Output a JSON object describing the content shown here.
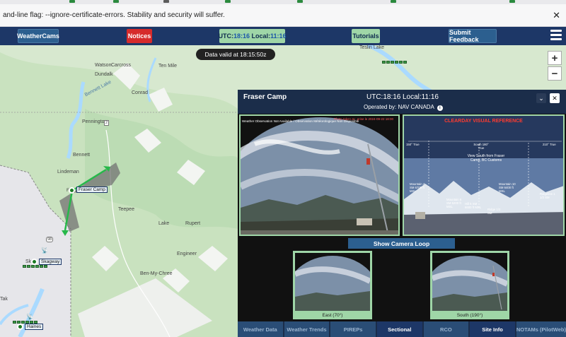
{
  "browser": {
    "warning": "and-line flag: --ignore-certificate-errors. Stability and security will suffer.",
    "close_icon": "close-icon",
    "tab_favicon_colors": [
      "#2b8a3e",
      "#2b8a3e",
      "#5b5b5b",
      "#2b8a3e",
      "#2b8a3e",
      "#2b8a3e",
      "#2b8a3e"
    ]
  },
  "nav": {
    "weathercams": "WeatherCams",
    "notices": "Notices",
    "utc_label": "UTC:",
    "utc_time": "18:16",
    "local_label": " Local:",
    "local_time": "11:16",
    "tutorials": "Tutorials",
    "feedback": "Submit Feedback",
    "menu_icon": "hamburger-menu-icon"
  },
  "map": {
    "validity": "Data valid at 18:15:50z",
    "zoom_in": "+",
    "zoom_out": "−",
    "places": [
      "Teslin Lake",
      "Carcross",
      "Ten Mile",
      "Watson",
      "Bennett Lake",
      "Dundalk",
      "Conrad",
      "Pennington",
      "Bennett",
      "Lindeman",
      "Teepee",
      "Lake",
      "Rupert",
      "Engineer",
      "Ben-My-Chree",
      "Sk",
      "Tak"
    ],
    "sites": [
      "Fraser Camp",
      "Skagway",
      "Haines"
    ],
    "markers": [
      "2",
      "98",
      "F"
    ],
    "colors": {
      "water": "#aadaff",
      "land": "#d7e8cf",
      "green": "#bcdcb4",
      "border": "#888888"
    }
  },
  "panel": {
    "site_name": "Fraser Camp",
    "utc": "UTC:18:16",
    "local": "Local:11:16",
    "operator": "Operated by: NAV CANADA",
    "collapse_icon": "chevron-down-icon",
    "close_icon": "close-icon",
    "info_icon": "info-icon",
    "camera_overlay": "Weather Observation Not Available / Observation Météorologique Non Disponible",
    "camera_timestamp": "Photo taken at : prise le 2024-09-22 18:00",
    "reference_title": "CLEARDAY VISUAL REFERENCE",
    "reference_note": "View South from Fraser Camp, BC Customs",
    "reference_bearings": [
      "150° True",
      "South 180° True",
      "210° True"
    ],
    "reference_peaks": [
      "Mountain 4 SM 6700 ft MSL",
      "Mountain 6 SM 5200 ft MSL",
      "Hill 5 SM 6600 ft MSL",
      "Ridge 1/2 SM",
      "Mountain 10 SM 6400 ft MSL",
      "Ridgeline 1 1/2 SM"
    ],
    "loop_button": "Show Camera Loop",
    "thumbnails": [
      {
        "caption": "East (70°)"
      },
      {
        "caption": "South (190°)"
      }
    ],
    "tabs": [
      "Weather Data",
      "Weather Trends",
      "PIREPs",
      "Sectional",
      "RCO",
      "Site Info",
      "NOTAMs (PilotWeb)"
    ],
    "active_tabs": [
      "Sectional",
      "Site Info"
    ]
  }
}
